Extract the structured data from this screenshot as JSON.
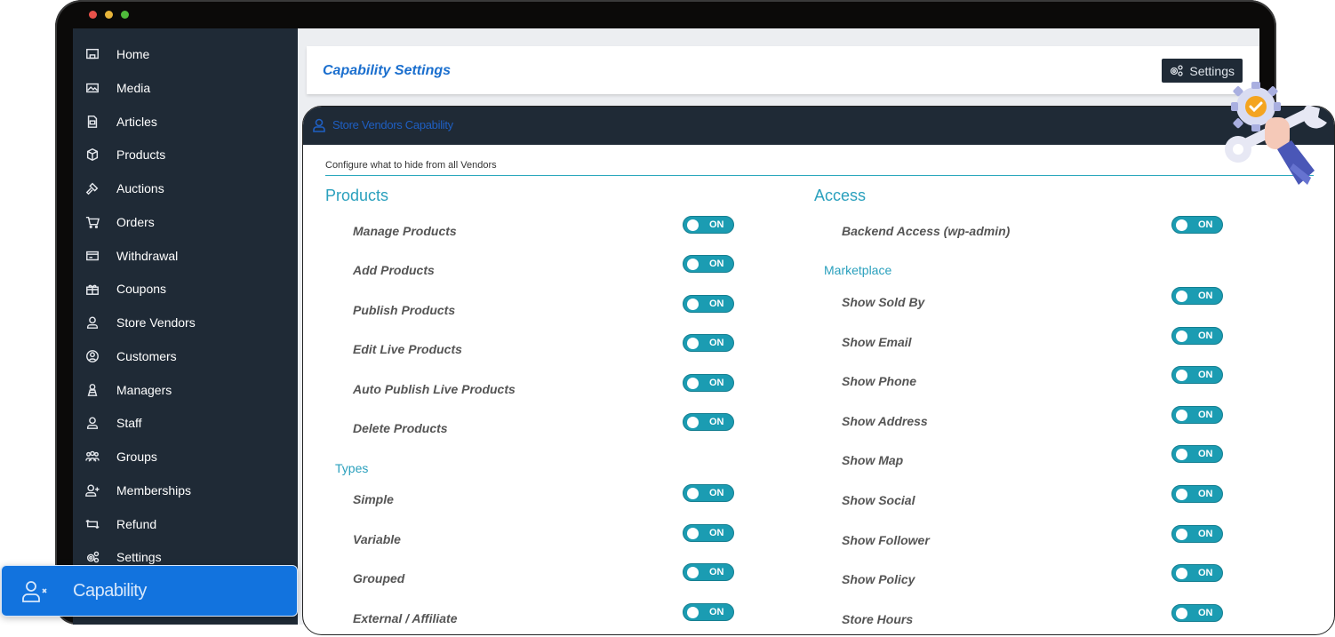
{
  "window": {
    "traffic_lights": [
      {
        "name": "close",
        "color": "#e9524a"
      },
      {
        "name": "minimize",
        "color": "#e8b53a"
      },
      {
        "name": "maximize",
        "color": "#4fbb3b"
      }
    ]
  },
  "sidebar": {
    "items": [
      {
        "label": "Home",
        "icon": "home-icon"
      },
      {
        "label": "Media",
        "icon": "image-icon"
      },
      {
        "label": "Articles",
        "icon": "document-icon"
      },
      {
        "label": "Products",
        "icon": "box-icon"
      },
      {
        "label": "Auctions",
        "icon": "gavel-icon"
      },
      {
        "label": "Orders",
        "icon": "cart-icon"
      },
      {
        "label": "Withdrawal",
        "icon": "credit-card-icon"
      },
      {
        "label": "Coupons",
        "icon": "gift-icon"
      },
      {
        "label": "Store Vendors",
        "icon": "user-icon"
      },
      {
        "label": "Customers",
        "icon": "user-circle-icon"
      },
      {
        "label": "Managers",
        "icon": "manager-icon"
      },
      {
        "label": "Staff",
        "icon": "user-icon"
      },
      {
        "label": "Groups",
        "icon": "users-group-icon"
      },
      {
        "label": "Memberships",
        "icon": "user-plus-icon"
      },
      {
        "label": "Refund",
        "icon": "refund-icon"
      },
      {
        "label": "Settings",
        "icon": "gears-icon"
      }
    ],
    "active": {
      "label": "Capability",
      "icon": "user-x-icon"
    }
  },
  "header": {
    "title": "Capability Settings",
    "settings_button": "Settings"
  },
  "card": {
    "title": "Store Vendors Capability",
    "configure_text": "Configure what to hide from all Vendors",
    "left": {
      "section": "Products",
      "options": [
        {
          "label": "Manage Products",
          "state": "ON"
        },
        {
          "label": "Add Products",
          "state": "ON"
        },
        {
          "label": "Publish Products",
          "state": "ON"
        },
        {
          "label": "Edit Live Products",
          "state": "ON"
        },
        {
          "label": "Auto Publish Live Products",
          "state": "ON"
        },
        {
          "label": "Delete Products",
          "state": "ON"
        }
      ],
      "subsection": "Types",
      "sub_options": [
        {
          "label": "Simple",
          "state": "ON"
        },
        {
          "label": "Variable",
          "state": "ON"
        },
        {
          "label": "Grouped",
          "state": "ON"
        },
        {
          "label": "External / Affiliate",
          "state": "ON"
        }
      ]
    },
    "right": {
      "section": "Access",
      "options": [
        {
          "label": "Backend Access (wp-admin)",
          "state": "ON"
        }
      ],
      "subsection": "Marketplace",
      "sub_options": [
        {
          "label": "Show Sold By",
          "state": "ON"
        },
        {
          "label": "Show Email",
          "state": "ON"
        },
        {
          "label": "Show Phone",
          "state": "ON"
        },
        {
          "label": "Show Address",
          "state": "ON"
        },
        {
          "label": "Show Map",
          "state": "ON"
        },
        {
          "label": "Show Social",
          "state": "ON"
        },
        {
          "label": "Show Follower",
          "state": "ON"
        },
        {
          "label": "Show Policy",
          "state": "ON"
        },
        {
          "label": "Store Hours",
          "state": "ON"
        }
      ]
    }
  },
  "colors": {
    "sidebar_bg": "#1f2a36",
    "accent_blue": "#1273de",
    "toggle_on": "#1b9cb2",
    "section_teal": "#2aa0bd",
    "title_blue": "#1b6fce"
  }
}
